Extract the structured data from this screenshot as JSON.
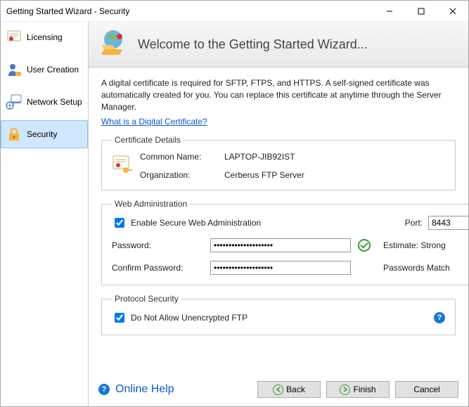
{
  "window": {
    "title": "Getting Started Wizard - Security"
  },
  "sidebar": {
    "items": [
      {
        "label": "Licensing"
      },
      {
        "label": "User Creation"
      },
      {
        "label": "Network Setup"
      },
      {
        "label": "Security"
      }
    ]
  },
  "banner": {
    "title": "Welcome to the Getting Started Wizard..."
  },
  "intro": "A digital certificate is required for SFTP, FTPS, and HTTPS.  A self-signed certificate was automatically created for you.  You can replace this certificate at anytime through the Server Manager.",
  "cert_link": "What is a Digital Certificate?",
  "cert": {
    "legend": "Certificate Details",
    "common_name_label": "Common Name:",
    "common_name_value": "LAPTOP-JIB92IST",
    "organization_label": "Organization:",
    "organization_value": "Cerberus FTP Server"
  },
  "webadmin": {
    "legend": "Web Administration",
    "enable_label": "Enable Secure Web Administration",
    "enable_checked": true,
    "port_label": "Port:",
    "port_value": "8443",
    "password_label": "Password:",
    "password_value": "••••••••••••••••••••",
    "confirm_label": "Confirm Password:",
    "confirm_value": "••••••••••••••••••••",
    "estimate_label": "Estimate: Strong",
    "match_label": "Passwords Match"
  },
  "protocol": {
    "legend": "Protocol Security",
    "no_unenc_label": "Do Not Allow Unencrypted FTP",
    "no_unenc_checked": true
  },
  "footer": {
    "online_help": "Online Help",
    "back": "Back",
    "finish": "Finish",
    "cancel": "Cancel"
  }
}
